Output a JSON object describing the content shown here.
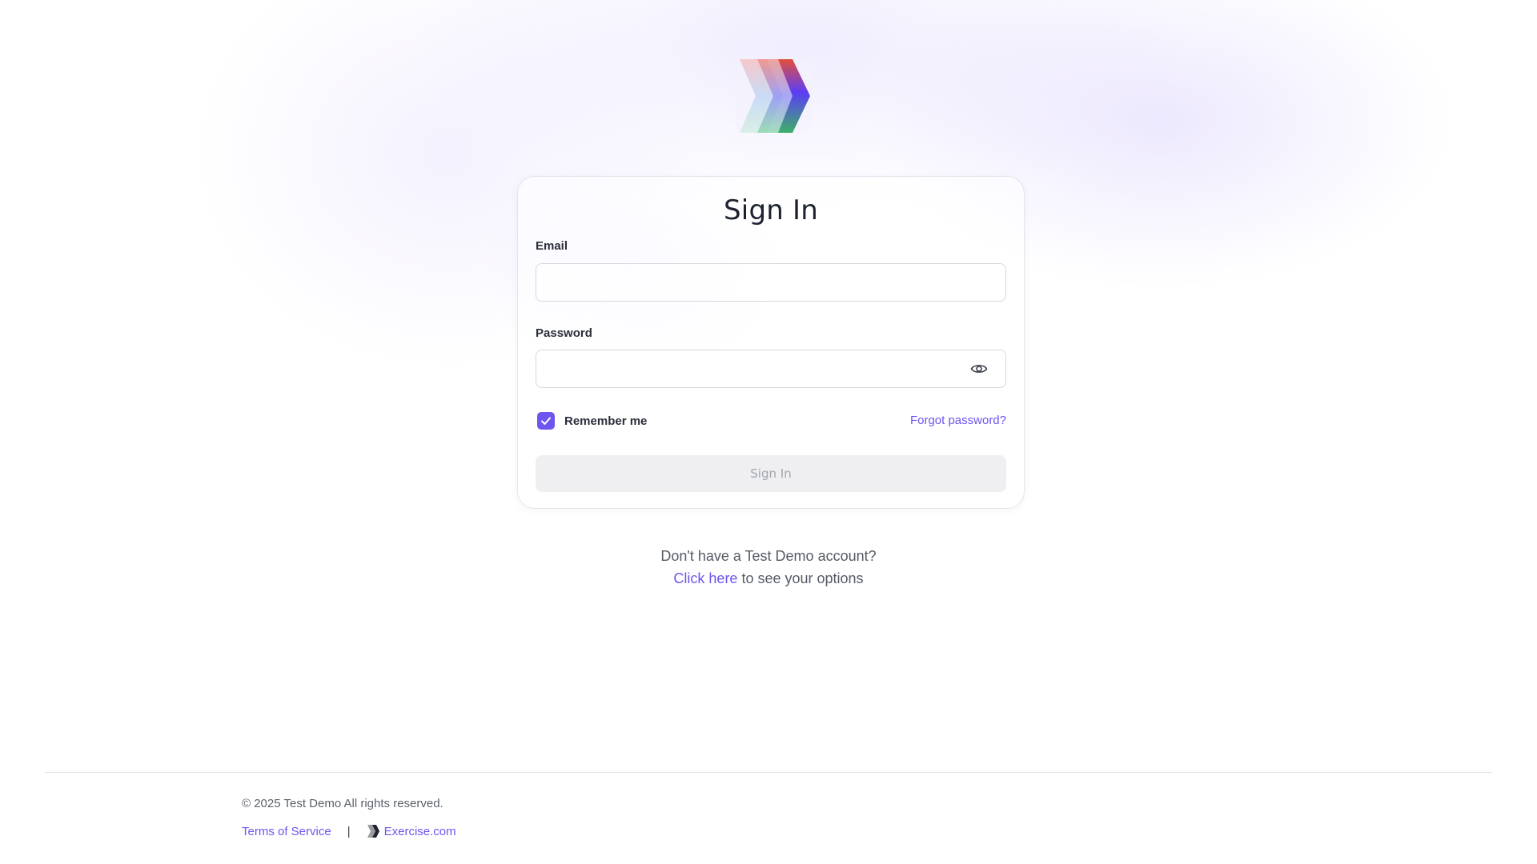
{
  "brand": {
    "logo_icon": "zigzag-gradient-logo-icon",
    "logo_colors": [
      "#e2503c",
      "#5b3df5",
      "#3fb06a"
    ]
  },
  "signin": {
    "title": "Sign In",
    "email_label": "Email",
    "email_value": "",
    "email_placeholder": "",
    "password_label": "Password",
    "password_value": "",
    "password_placeholder": "",
    "password_toggle_icon": "eye-icon",
    "remember_label": "Remember me",
    "remember_checked": true,
    "forgot_label": "Forgot password?",
    "submit_label": "Sign In"
  },
  "account": {
    "prompt": "Don't have a Test Demo account?",
    "link_label": "Click here",
    "suffix": " to see your options"
  },
  "footer": {
    "copyright": "© 2025 Test Demo All rights reserved.",
    "terms_label": "Terms of Service",
    "separator": "|",
    "exercise_label": "Exercise.com"
  },
  "colors": {
    "accent": "#6d55ee",
    "button_disabled_bg": "#efeff1",
    "button_disabled_text": "#a3a6ad"
  }
}
